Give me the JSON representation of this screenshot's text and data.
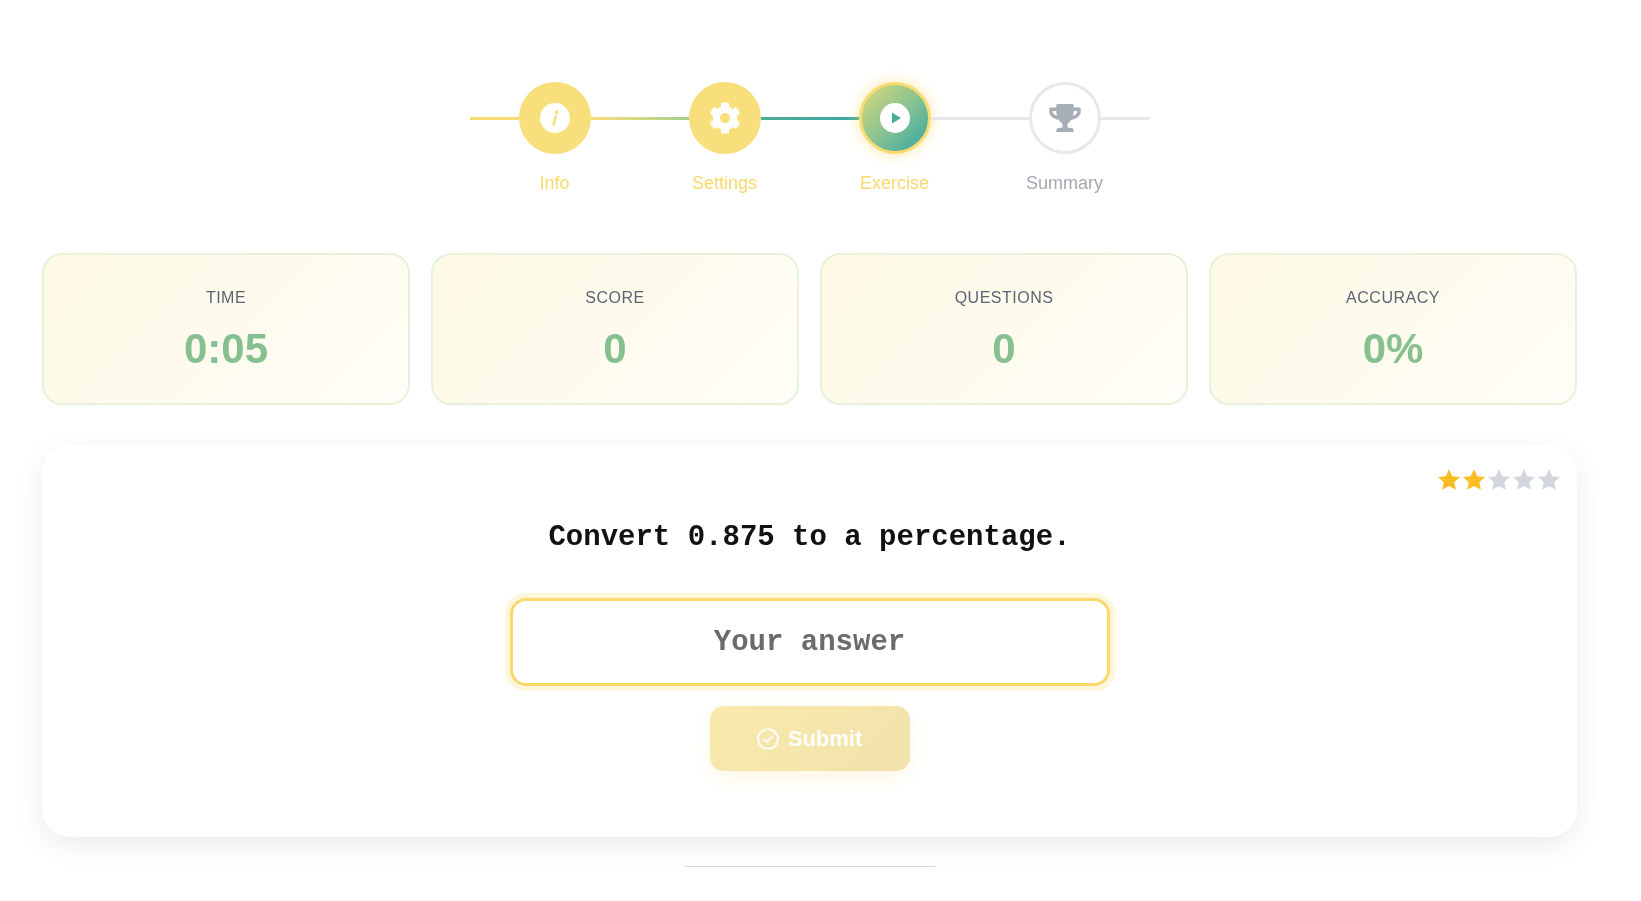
{
  "stepper": {
    "steps": [
      {
        "label": "Info",
        "completed": true,
        "selected": false
      },
      {
        "label": "Settings",
        "completed": true,
        "selected": false
      },
      {
        "label": "Exercise",
        "completed": false,
        "selected": true
      },
      {
        "label": "Summary",
        "completed": false,
        "selected": false
      }
    ]
  },
  "stats": [
    {
      "label": "TIME",
      "value": "0:05"
    },
    {
      "label": "SCORE",
      "value": "0"
    },
    {
      "label": "QUESTIONS",
      "value": "0"
    },
    {
      "label": "ACCURACY",
      "value": "0%"
    }
  ],
  "exercise": {
    "stars": 2,
    "question": "Convert 0.875 to a percentage.",
    "answer": {
      "placeholder": "Your answer"
    },
    "submit": {
      "label": "Submit",
      "disabled": true
    }
  }
}
